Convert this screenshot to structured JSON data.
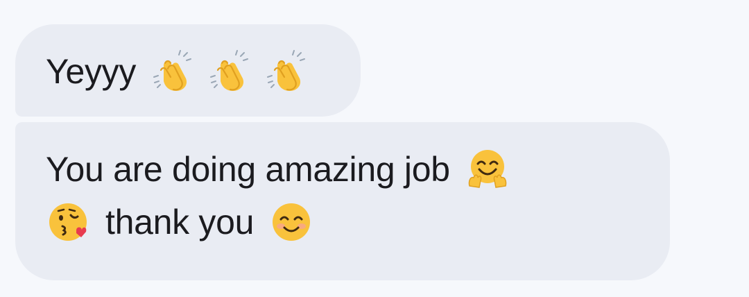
{
  "messages": [
    {
      "text": "Yeyyy",
      "emojis": [
        "clapping-hands",
        "clapping-hands",
        "clapping-hands"
      ]
    },
    {
      "line1_text": "You are doing amazing job",
      "line1_emoji": "hugging-face",
      "line2_emoji_before": "face-blowing-kiss",
      "line2_text": "thank you",
      "line2_emoji_after": "smiling-face-with-smiling-eyes"
    }
  ],
  "colors": {
    "background": "#f6f8fc",
    "bubble": "#e9ecf3",
    "text": "#1b1b1f",
    "emoji_yellow": "#f9c23c"
  }
}
